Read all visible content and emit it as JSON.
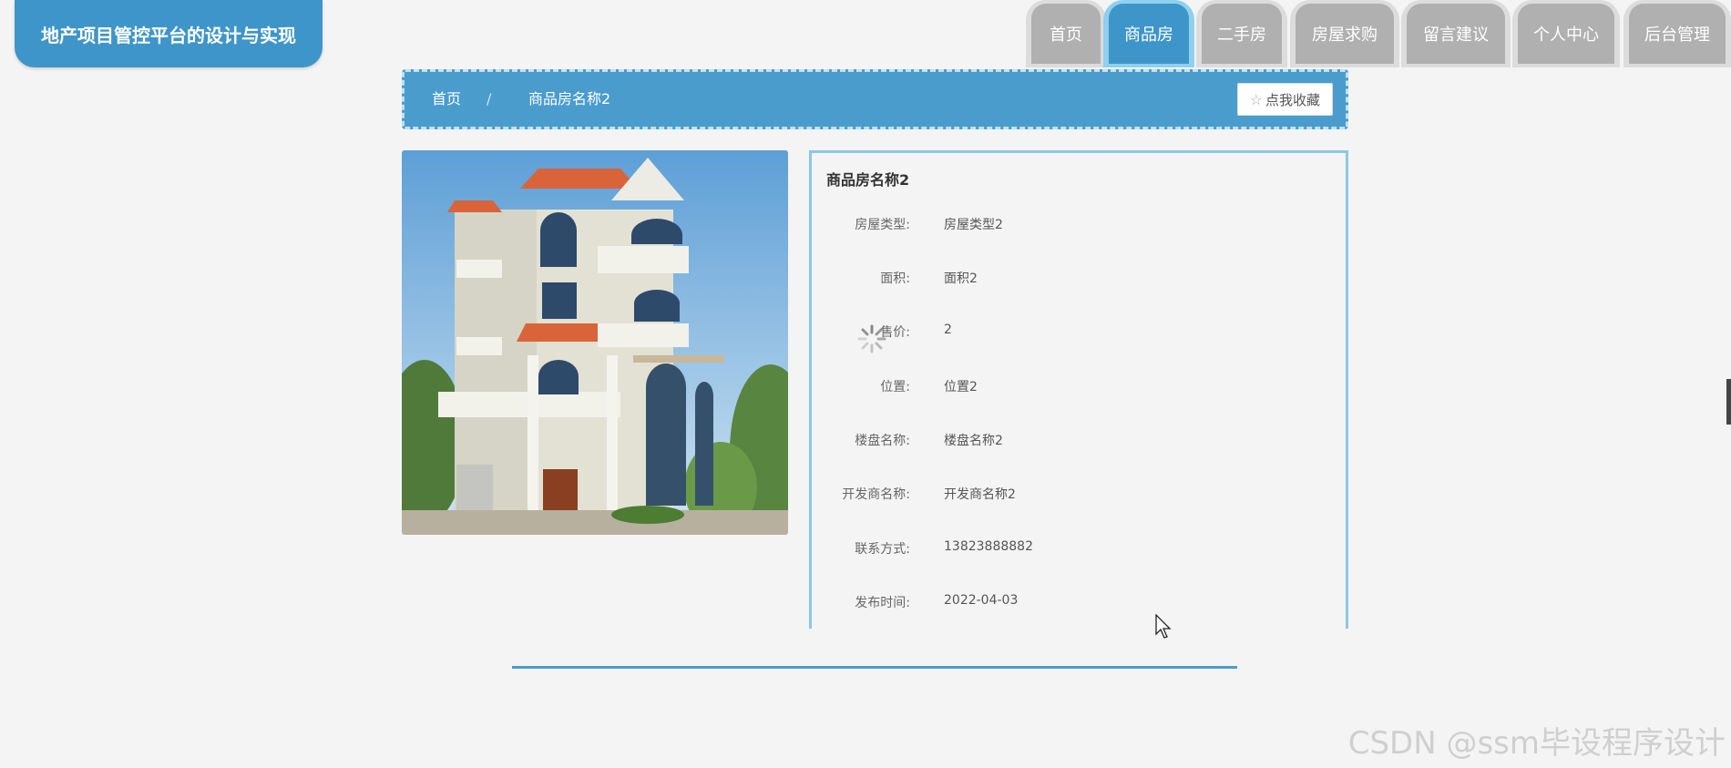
{
  "app": {
    "title": "地产项目管控平台的设计与实现"
  },
  "nav": {
    "items": [
      {
        "label": "首页",
        "active": false
      },
      {
        "label": "商品房",
        "active": true
      },
      {
        "label": "二手房",
        "active": false
      },
      {
        "label": "房屋求购",
        "active": false
      },
      {
        "label": "留言建议",
        "active": false
      },
      {
        "label": "个人中心",
        "active": false
      },
      {
        "label": "后台管理",
        "active": false
      }
    ]
  },
  "breadcrumb": {
    "home": "首页",
    "separator": "/",
    "current": "商品房名称2"
  },
  "favorite": {
    "label": "点我收藏",
    "icon": "star-outline-icon"
  },
  "detail": {
    "title": "商品房名称2",
    "fields": [
      {
        "label": "房屋类型:",
        "value": "房屋类型2"
      },
      {
        "label": "面积:",
        "value": "面积2"
      },
      {
        "label": "售价:",
        "value": "2"
      },
      {
        "label": "位置:",
        "value": "位置2"
      },
      {
        "label": "楼盘名称:",
        "value": "楼盘名称2"
      },
      {
        "label": "开发商名称:",
        "value": "开发商名称2"
      },
      {
        "label": "联系方式:",
        "value": "13823888882"
      },
      {
        "label": "发布时间:",
        "value": "2022-04-03"
      }
    ]
  },
  "watermark": "CSDN @ssm毕设程序设计",
  "colors": {
    "accent": "#3e95c9",
    "tab_inactive": "#b0b0b0",
    "background": "#f4f4f4"
  }
}
